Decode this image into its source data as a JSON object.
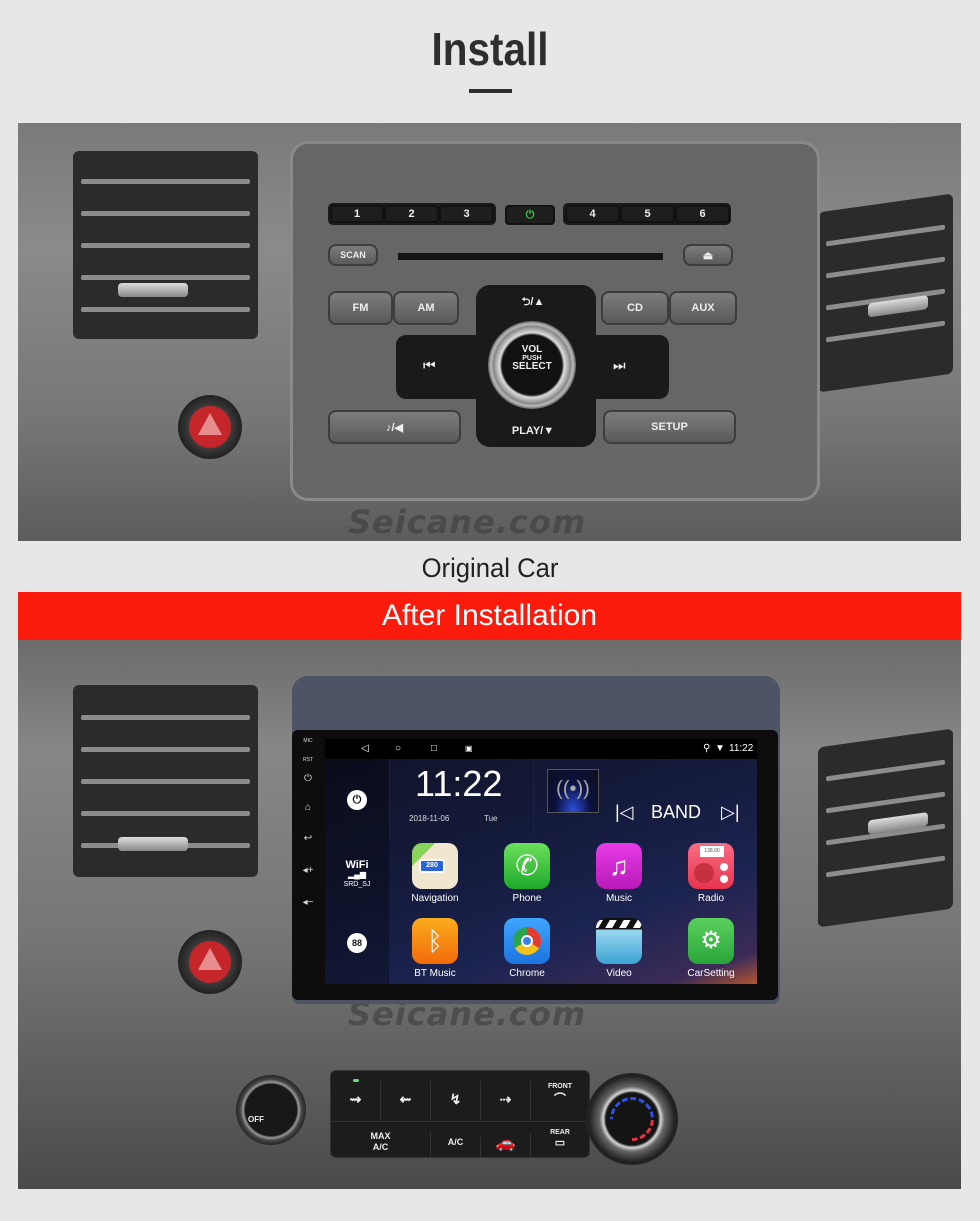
{
  "page": {
    "title": "Install",
    "original_caption": "Original Car",
    "after_banner": "After Installation",
    "watermark": "Seicane.com",
    "colors": {
      "banner": "#fa1b0c",
      "background": "#e7e7e7",
      "title": "#2e2e2e"
    }
  },
  "original_radio": {
    "presets": [
      "1",
      "2",
      "3",
      "4",
      "5",
      "6"
    ],
    "power_icon": "power-icon",
    "scan": "SCAN",
    "eject_icon": "eject-icon",
    "fm": "FM",
    "am": "AM",
    "cd": "CD",
    "aux": "AUX",
    "back_up": "⮌/▲",
    "prev_icon": "⏮",
    "next_icon": "⏭",
    "knob": {
      "line1": "VOL",
      "line2": "PUSH",
      "line3": "SELECT"
    },
    "play_down": "PLAY/▼",
    "sound": "♪/◀",
    "setup": "SETUP"
  },
  "head_unit": {
    "side_labels": [
      "MIC",
      "RST"
    ],
    "side_icons": [
      "power-icon",
      "home-icon",
      "back-icon",
      "volume-up-icon",
      "volume-down-icon"
    ],
    "nav": {
      "back": "◁",
      "home": "○",
      "recents": "□",
      "screenshot": "▣"
    },
    "status": {
      "time": "11:22",
      "location_icon": "location-icon",
      "wifi_icon": "wifi-icon"
    },
    "clock": {
      "time": "11:22",
      "date": "2018-11-06",
      "day": "Tue"
    },
    "media": {
      "prev": "K",
      "band": "BAND",
      "next": "K"
    },
    "wifi": {
      "label": "WiFi",
      "ssid": "SRD_SJ"
    },
    "power_button": "⏻",
    "all_apps_button": "88",
    "apps": [
      {
        "label": "Navigation",
        "icon": "navigation-icon",
        "color": "#f0e6cc",
        "badge": "280"
      },
      {
        "label": "Phone",
        "icon": "phone-icon",
        "color": "#3cc43c"
      },
      {
        "label": "Music",
        "icon": "music-icon",
        "color": "#d426d4"
      },
      {
        "label": "Radio",
        "icon": "radio-icon",
        "color": "#f04a63",
        "freq": "138.00"
      },
      {
        "label": "BT Music",
        "icon": "bluetooth-music-icon",
        "color": "#f68a12"
      },
      {
        "label": "Chrome",
        "icon": "chrome-icon",
        "color": "#2f8cf0"
      },
      {
        "label": "Video",
        "icon": "video-icon",
        "color": "#6fc4e8"
      },
      {
        "label": "CarSetting",
        "icon": "car-setting-icon",
        "color": "#3dbb44"
      }
    ]
  },
  "climate": {
    "off": "OFF",
    "front": "FRONT",
    "rear": "REAR",
    "max_ac": "MAX A/C",
    "ac": "A/C"
  }
}
